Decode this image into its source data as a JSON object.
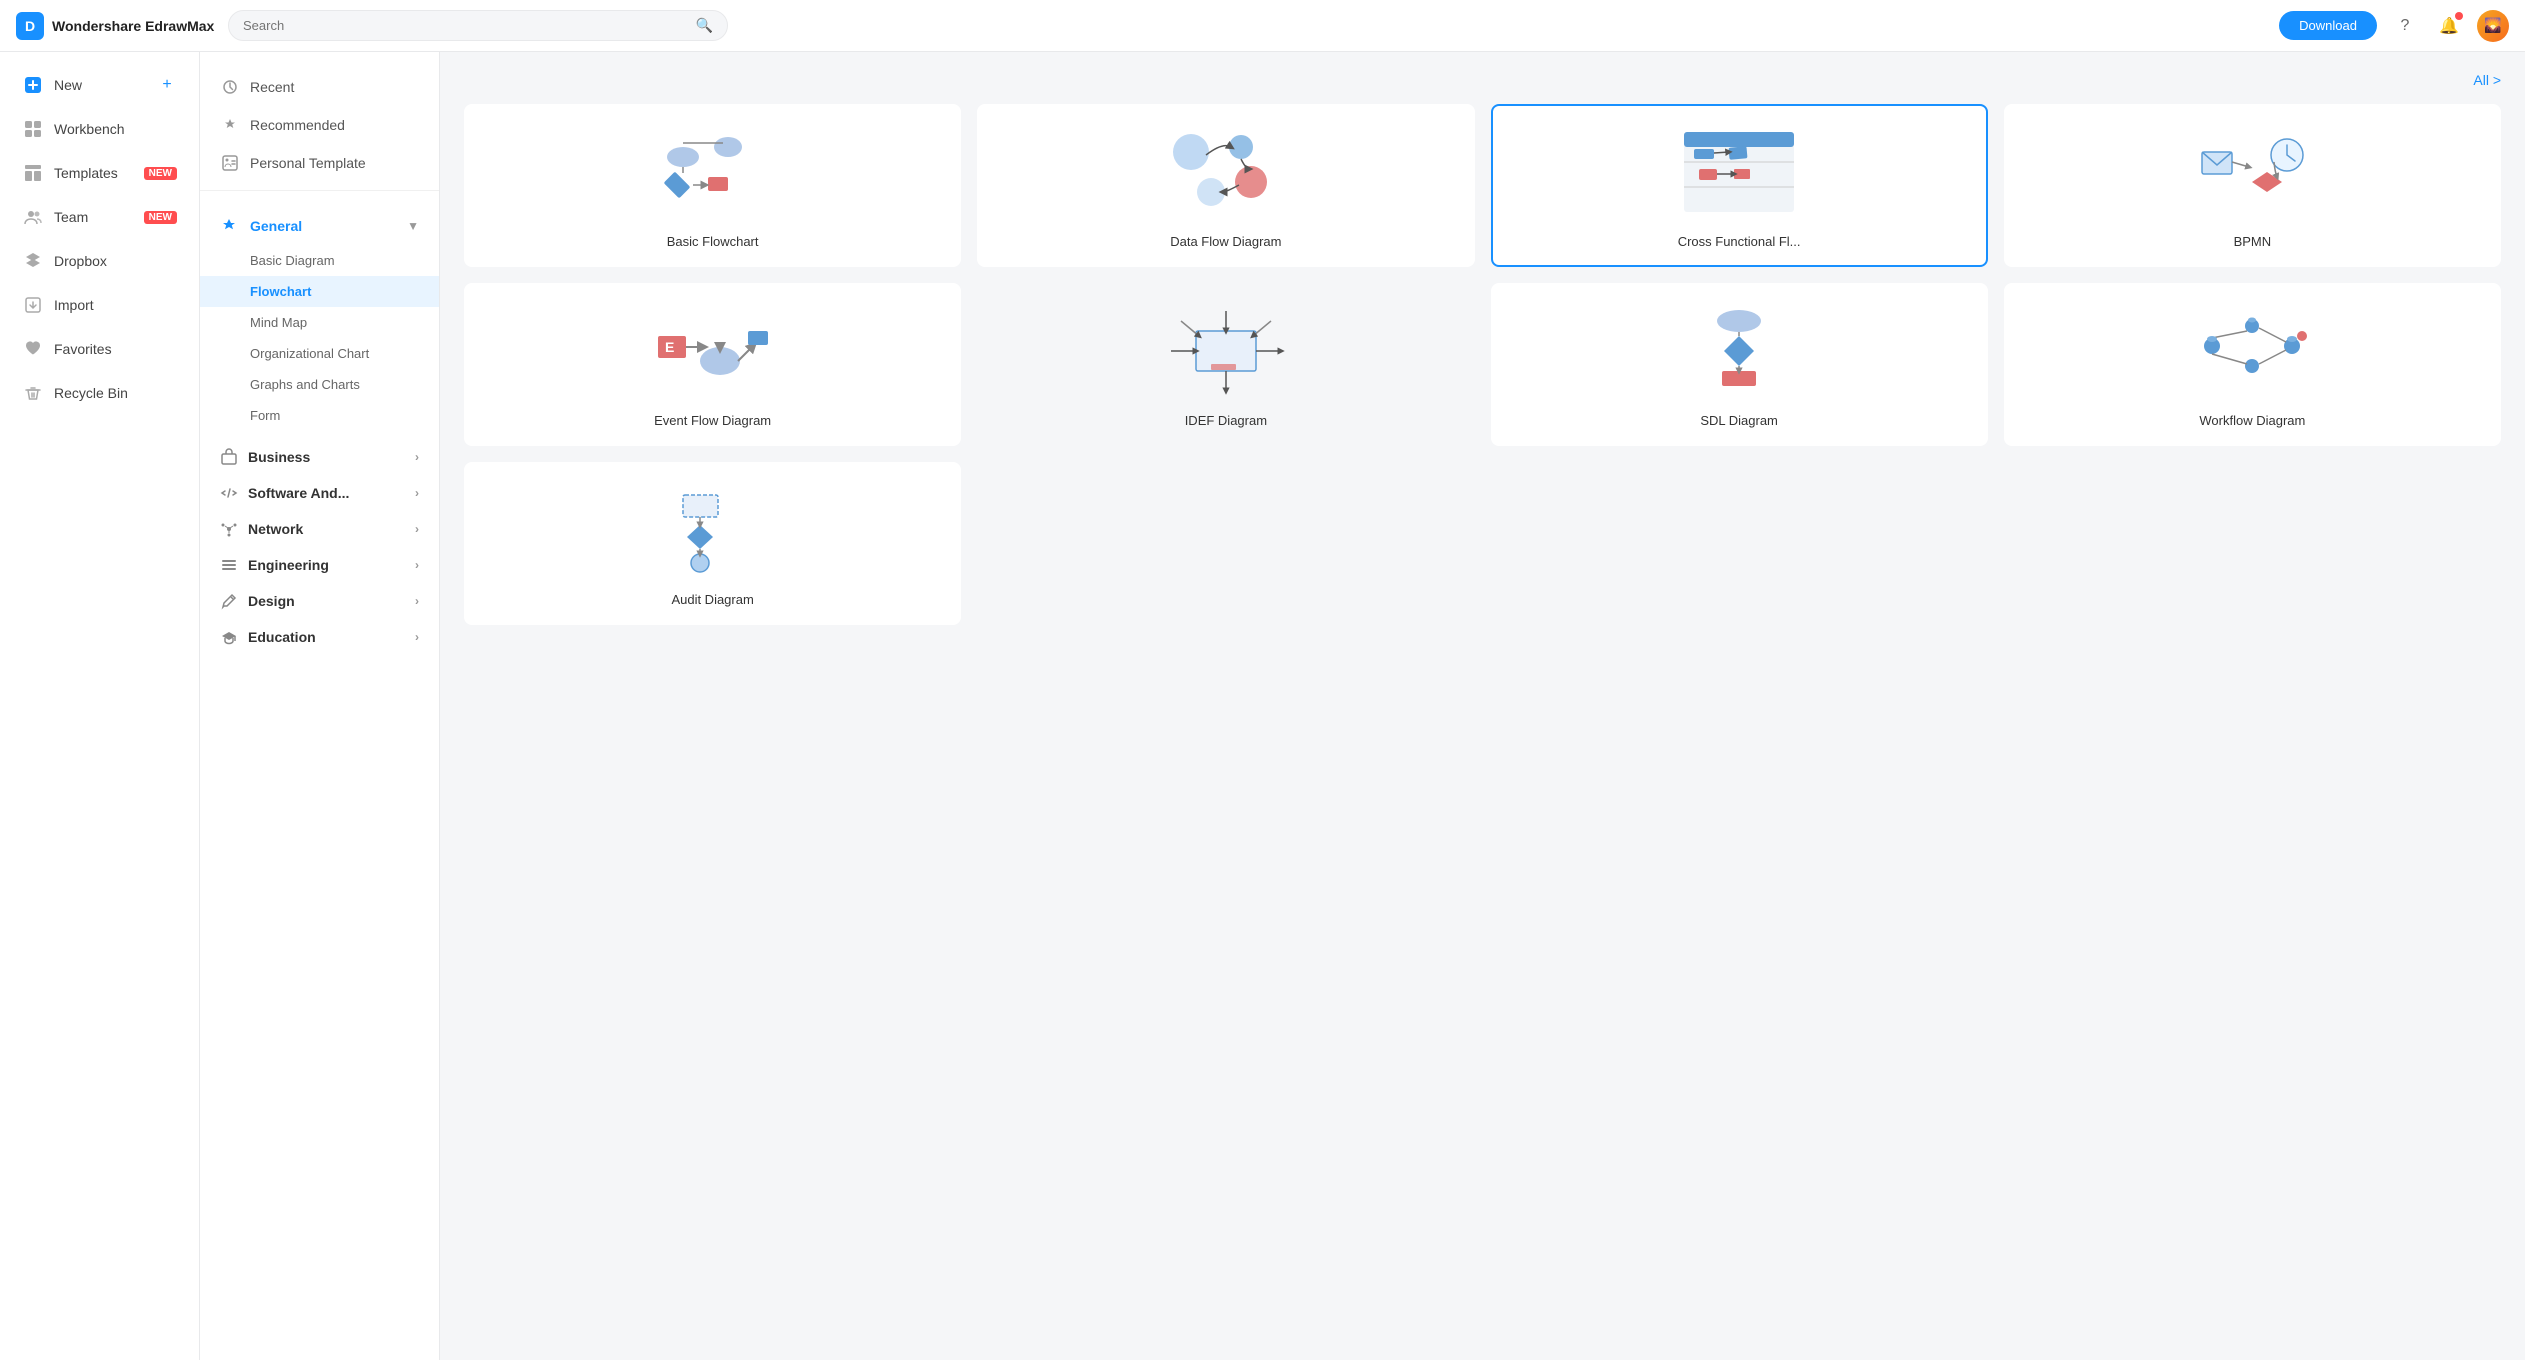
{
  "header": {
    "logo_text": "Wondershare EdrawMax",
    "search_placeholder": "Search",
    "download_label": "Download"
  },
  "sidebar": {
    "items": [
      {
        "id": "new",
        "label": "New",
        "icon": "plus-square",
        "badge": null,
        "has_add": true
      },
      {
        "id": "workbench",
        "label": "Workbench",
        "icon": "grid",
        "badge": null
      },
      {
        "id": "templates",
        "label": "Templates",
        "icon": "layout",
        "badge": "NEW"
      },
      {
        "id": "team",
        "label": "Team",
        "icon": "users",
        "badge": "NEW"
      },
      {
        "id": "dropbox",
        "label": "Dropbox",
        "icon": "cloud",
        "badge": null
      },
      {
        "id": "import",
        "label": "Import",
        "icon": "import",
        "badge": null
      },
      {
        "id": "favorites",
        "label": "Favorites",
        "icon": "heart",
        "badge": null
      },
      {
        "id": "recycle",
        "label": "Recycle Bin",
        "icon": "trash",
        "badge": null
      }
    ]
  },
  "nav_panel": {
    "top_items": [
      {
        "id": "recent",
        "label": "Recent",
        "icon": "clock"
      },
      {
        "id": "recommended",
        "label": "Recommended",
        "icon": "star"
      },
      {
        "id": "personal",
        "label": "Personal Template",
        "icon": "template"
      }
    ],
    "categories": [
      {
        "id": "general",
        "label": "General",
        "icon": "diamond",
        "expanded": true,
        "color": "#1890ff",
        "subcategories": [
          {
            "id": "basic-diagram",
            "label": "Basic Diagram",
            "active": false
          },
          {
            "id": "flowchart",
            "label": "Flowchart",
            "active": true
          },
          {
            "id": "mind-map",
            "label": "Mind Map",
            "active": false
          },
          {
            "id": "org-chart",
            "label": "Organizational Chart",
            "active": false
          },
          {
            "id": "graphs",
            "label": "Graphs and Charts",
            "active": false
          },
          {
            "id": "form",
            "label": "Form",
            "active": false
          }
        ]
      },
      {
        "id": "business",
        "label": "Business",
        "icon": "briefcase",
        "expanded": false
      },
      {
        "id": "software",
        "label": "Software And...",
        "icon": "code",
        "expanded": false
      },
      {
        "id": "network",
        "label": "Network",
        "icon": "network",
        "expanded": false
      },
      {
        "id": "engineering",
        "label": "Engineering",
        "icon": "engineering",
        "expanded": false
      },
      {
        "id": "design",
        "label": "Design",
        "icon": "design",
        "expanded": false
      },
      {
        "id": "education",
        "label": "Education",
        "icon": "education",
        "expanded": false
      }
    ]
  },
  "content": {
    "all_label": "All >",
    "diagrams": [
      {
        "id": "basic-flowchart",
        "label": "Basic Flowchart",
        "selected": false,
        "hovered": false
      },
      {
        "id": "data-flow",
        "label": "Data Flow Diagram",
        "selected": false,
        "hovered": false
      },
      {
        "id": "cross-functional",
        "label": "Cross Functional Fl...",
        "selected": true,
        "hovered": false
      },
      {
        "id": "bpmn",
        "label": "BPMN",
        "selected": false,
        "hovered": false
      },
      {
        "id": "event-flow",
        "label": "Event Flow Diagram",
        "selected": false,
        "hovered": false
      },
      {
        "id": "idef",
        "label": "IDEF Diagram",
        "selected": false,
        "hovered": true
      },
      {
        "id": "sdl",
        "label": "SDL Diagram",
        "selected": false,
        "hovered": false
      },
      {
        "id": "workflow",
        "label": "Workflow Diagram",
        "selected": false,
        "hovered": false
      },
      {
        "id": "audit",
        "label": "Audit Diagram",
        "selected": false,
        "hovered": false
      }
    ]
  }
}
